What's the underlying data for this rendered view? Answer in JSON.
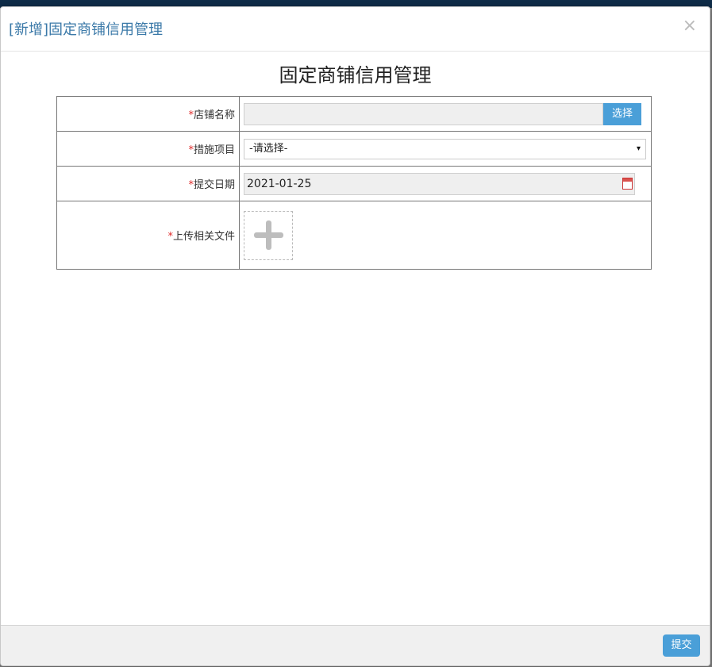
{
  "modal": {
    "title": "[新增]固定商铺信用管理",
    "close_symbol": "×"
  },
  "form": {
    "title": "固定商铺信用管理",
    "required_mark": "*",
    "fields": [
      {
        "label": "店铺名称",
        "value": "",
        "button_label": "选择"
      },
      {
        "label": "措施项目",
        "selected": "-请选择-",
        "arrow": "▾"
      },
      {
        "label": "提交日期",
        "value": "2021-01-25"
      },
      {
        "label": "上传相关文件"
      }
    ]
  },
  "footer": {
    "submit_label": "提交"
  },
  "colors": {
    "accent": "#4a9fd8",
    "title_blue": "#3b79a8",
    "required": "#e02b2b"
  },
  "icons": [
    "close-icon",
    "calendar-icon",
    "plus-icon",
    "dropdown-arrow-icon"
  ]
}
